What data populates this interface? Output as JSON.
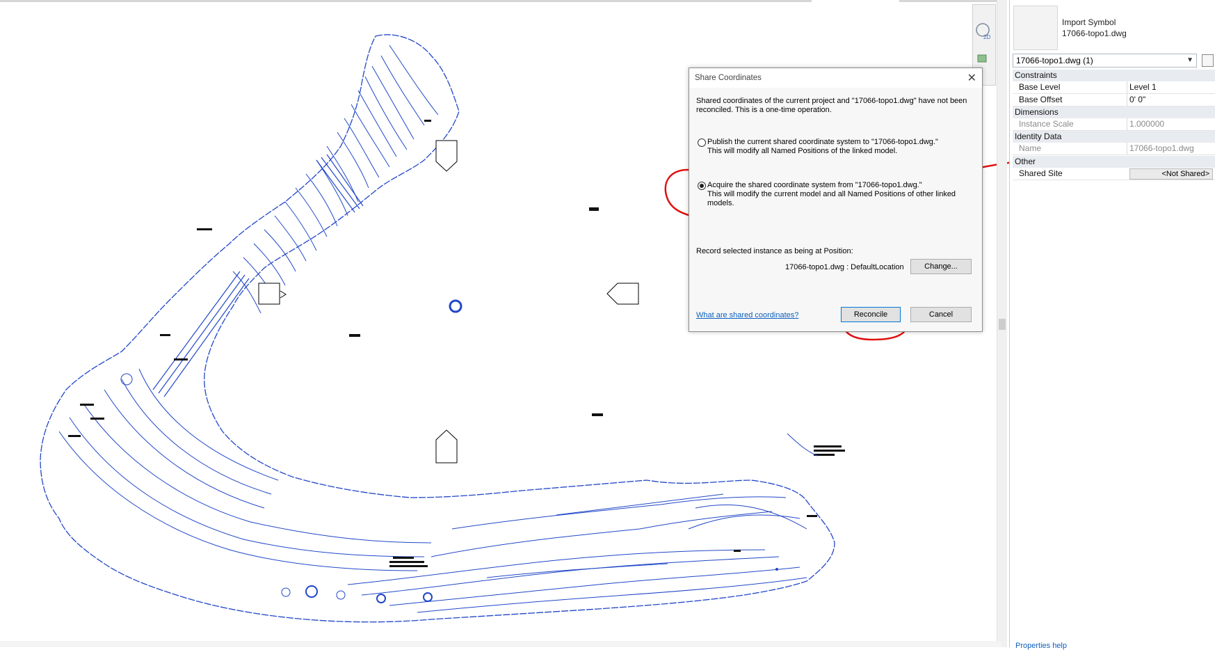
{
  "dialog": {
    "title": "Share Coordinates",
    "intro_line1": "Shared coordinates of the current project and \"17066-topo1.dwg\" have not been",
    "intro_line2": "reconciled. This is a one-time operation.",
    "option_publish": {
      "line1": "Publish the current shared coordinate system to \"17066-topo1.dwg.\"",
      "line2": "This will modify all Named Positions of the linked model.",
      "selected": false
    },
    "option_acquire": {
      "line1": "Acquire the shared coordinate system from \"17066-topo1.dwg.\"",
      "line2": "This will modify the current model and all Named Positions of other linked",
      "line3": "models.",
      "selected": true
    },
    "record_label": "Record selected instance as being at Position:",
    "position_value": "17066-topo1.dwg : DefaultLocation",
    "change_button": "Change...",
    "help_link": "What are shared coordinates?",
    "reconcile_button": "Reconcile",
    "cancel_button": "Cancel"
  },
  "properties": {
    "type_line1": "Import Symbol",
    "type_line2": "17066-topo1.dwg",
    "selector": "17066-topo1.dwg (1)",
    "groups": {
      "constraints": "Constraints",
      "dimensions": "Dimensions",
      "identity": "Identity Data",
      "other": "Other"
    },
    "rows": {
      "base_level": {
        "name": "Base Level",
        "value": "Level 1"
      },
      "base_offset": {
        "name": "Base Offset",
        "value": "0'  0\""
      },
      "instance_scale": {
        "name": "Instance Scale",
        "value": "1.000000"
      },
      "name": {
        "name": "Name",
        "value": "17066-topo1.dwg"
      },
      "shared_site": {
        "name": "Shared Site",
        "value": "<Not Shared>"
      }
    },
    "help": "Properties help"
  },
  "colors": {
    "drawing_blue": "#2046c8",
    "annotation_red": "#e01010",
    "link_blue": "#0b5fbf"
  }
}
